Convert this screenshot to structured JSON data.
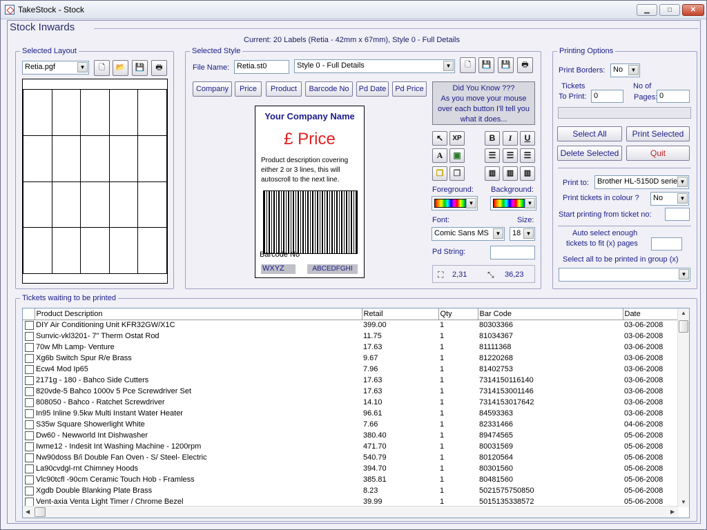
{
  "window": {
    "title": "TakeStock - Stock",
    "min": "▁",
    "max": "□",
    "close": "✕"
  },
  "page": {
    "title": "Stock Inwards",
    "current": "Current: 20 Labels (Retia - 42mm x 67mm), Style 0 - Full Details"
  },
  "layout": {
    "legend": "Selected Layout",
    "file": "Retia.pgf"
  },
  "style": {
    "legend": "Selected Style",
    "file_label": "File Name:",
    "file": "Retia.st0",
    "style_select": "Style 0 - Full Details",
    "fields": [
      "Company",
      "Price",
      "Product",
      "Barcode No",
      "Pd Date",
      "Pd Price"
    ],
    "tip": {
      "title": "Did You Know ???",
      "text": "As you move your mouse over each button I'll tell you what it does..."
    },
    "ticket": {
      "company": "Your Company Name",
      "price": "£ Price",
      "description": "Product description covering either 2 or 3 lines, this will autoscroll to the next line.",
      "barcode_label": "Barcode No",
      "code1": "WXYZ",
      "code2": "ABCEDFGHI"
    },
    "format": {
      "bold": "B",
      "italic": "I",
      "underline": "U"
    },
    "foreground_label": "Foreground:",
    "background_label": "Background:",
    "font_label": "Font:",
    "size_label": "Size:",
    "font": "Comic Sans MS",
    "size": "18",
    "pd_string_label": "Pd String:",
    "pd_string": "",
    "pos": "2,31",
    "dims": "36,23"
  },
  "printing": {
    "legend": "Printing Options",
    "borders_label": "Print Borders:",
    "borders": "No",
    "tickets_label1": "Tickets",
    "tickets_label2": "To Print:",
    "tickets": "0",
    "pages_label1": "No of",
    "pages_label2": "Pages:",
    "pages": "0",
    "select_all": "Select All",
    "print_selected": "Print Selected",
    "delete_selected": "Delete Selected",
    "quit": "Quit",
    "print_to_label": "Print to:",
    "printer": "Brother HL-5150D series",
    "colour_label": "Print tickets in colour ?",
    "colour": "No",
    "start_label": "Start printing from ticket no:",
    "start": "",
    "auto_label1": "Auto select enough",
    "auto_label2": "tickets to fit (x) pages",
    "auto": "",
    "group_label": "Select all to be printed in group (x)",
    "group": ""
  },
  "tickets": {
    "legend": "Tickets waiting to be printed",
    "columns": [
      "Product Description",
      "Retail",
      "Qty",
      "Bar Code",
      "Date"
    ],
    "rows": [
      [
        "DIY Air Conditioning Unit KFR32GW/X1C",
        "399.00",
        "1",
        "80303366",
        "03-06-2008"
      ],
      [
        "Sunvic-vkl3201- 7\" Therm Ostat Rod",
        "11.75",
        "1",
        "81034367",
        "03-06-2008"
      ],
      [
        "70w Mh Lamp- Venture",
        "17.63",
        "1",
        "81111368",
        "03-06-2008"
      ],
      [
        "Xg6b Switch Spur R/e Brass",
        "9.67",
        "1",
        "81220268",
        "03-06-2008"
      ],
      [
        "Ecw4 Mod Ip65",
        "7.96",
        "1",
        "81402753",
        "03-06-2008"
      ],
      [
        "2171g - 180 - Bahco Side Cutters",
        "17.63",
        "1",
        "7314150116140",
        "03-06-2008"
      ],
      [
        "820vde-5 Bahco 1000v  5 Pce Screwdriver Set",
        "17.63",
        "1",
        "7314153001146",
        "03-06-2008"
      ],
      [
        "808050  - Bahco - Ratchet Screwdriver",
        "14.10",
        "1",
        "7314153017642",
        "03-06-2008"
      ],
      [
        "In95 Inline 9.5kw Multi Instant Water Heater",
        "96.61",
        "1",
        "84593363",
        "03-06-2008"
      ],
      [
        "S35w Square Showerlight White",
        "7.66",
        "1",
        "82331466",
        "04-06-2008"
      ],
      [
        "Dw60 - Newworld Int Dishwasher",
        "380.40",
        "1",
        "89474565",
        "05-06-2008"
      ],
      [
        "Iwme12 - Indesit Int Washing Machine - 1200rpm",
        "471.70",
        "1",
        "80031569",
        "05-06-2008"
      ],
      [
        "Nw90doss B/i Double Fan Oven - S/ Steel- Electric",
        "540.79",
        "1",
        "80120564",
        "05-06-2008"
      ],
      [
        "La90cvdgl-rnt Chimney Hoods",
        "394.70",
        "1",
        "80301560",
        "05-06-2008"
      ],
      [
        "Vlc90tcfl  -90cm Ceramic Touch Hob - Framless",
        "385.81",
        "1",
        "80481560",
        "05-06-2008"
      ],
      [
        "Xgdb Double Blanking Plate Brass",
        "8.23",
        "1",
        "5021575750850",
        "05-06-2008"
      ],
      [
        "Vent-axia Venta Light Timer / Chrome Bezel",
        "39.99",
        "1",
        "5015135338572",
        "05-06-2008"
      ]
    ]
  }
}
